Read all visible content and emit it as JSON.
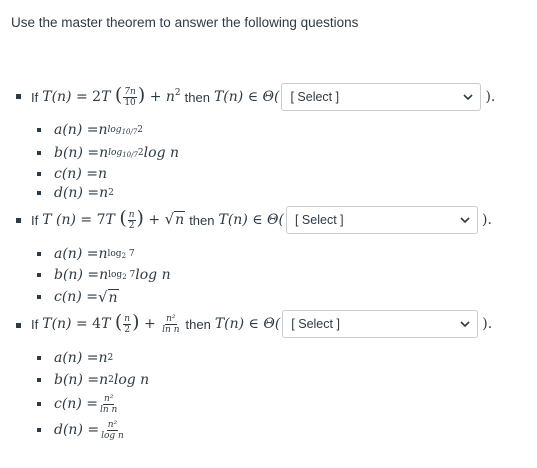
{
  "intro": "Use the master theorem to answer the following questions",
  "questions": [
    {
      "prefix": "If",
      "recurrence": {
        "coef": "2",
        "arg_num": "7n",
        "arg_den": "10",
        "add": "n",
        "add_exp": "2"
      },
      "then": "then",
      "select_value": "[ Select ]",
      "options": [
        {
          "lhs": "a(n) = ",
          "base": "n",
          "exp": "log",
          "exp_sub": "10/7",
          "exp_tail": "2",
          "tail": ""
        },
        {
          "lhs": "b(n) = ",
          "base": "n",
          "exp": "log",
          "exp_sub": "10/7",
          "exp_tail": "2",
          "tail": " log n"
        },
        {
          "lhs": "c(n) = ",
          "base": "n",
          "exp": "",
          "exp_sub": "",
          "exp_tail": "",
          "tail": ""
        },
        {
          "lhs": "d(n) = ",
          "base": "n",
          "exp": "2",
          "exp_sub": "",
          "exp_tail": "",
          "tail": ""
        }
      ]
    },
    {
      "prefix": "If",
      "recurrence": {
        "coef": "7",
        "arg_num": "n",
        "arg_den": "2",
        "add": "n"
      },
      "then": "then",
      "select_value": "[ Select ]",
      "options": [
        {
          "lhs": "a(n) = ",
          "base": "n",
          "exp": "log",
          "exp_sub": "2",
          "exp_tail": " 7",
          "tail": ""
        },
        {
          "lhs": "b(n) = ",
          "base": "n",
          "exp": "log",
          "exp_sub": "2",
          "exp_tail": " 7",
          "tail": " log n"
        },
        {
          "lhs": "c(n) = ",
          "sqrt": "n"
        }
      ]
    },
    {
      "prefix": "If",
      "recurrence": {
        "coef": "4",
        "arg_num": "n",
        "arg_den": "2",
        "frac_num": "n²",
        "frac_den": "ln n"
      },
      "then": "then",
      "select_value": "[ Select ]",
      "options": [
        {
          "lhs": "a(n) = ",
          "base": "n",
          "exp": "2",
          "tail": ""
        },
        {
          "lhs": "b(n) = ",
          "base": "n",
          "exp": "2",
          "tail": " log n"
        },
        {
          "lhs": "c(n) = ",
          "frac_num": "n²",
          "frac_den": "ln n"
        },
        {
          "lhs": "d(n) = ",
          "frac_num": "n²",
          "frac_den": "log n"
        }
      ]
    }
  ],
  "theta_prefix": "T(n) ∈ Θ(",
  "close": ")."
}
